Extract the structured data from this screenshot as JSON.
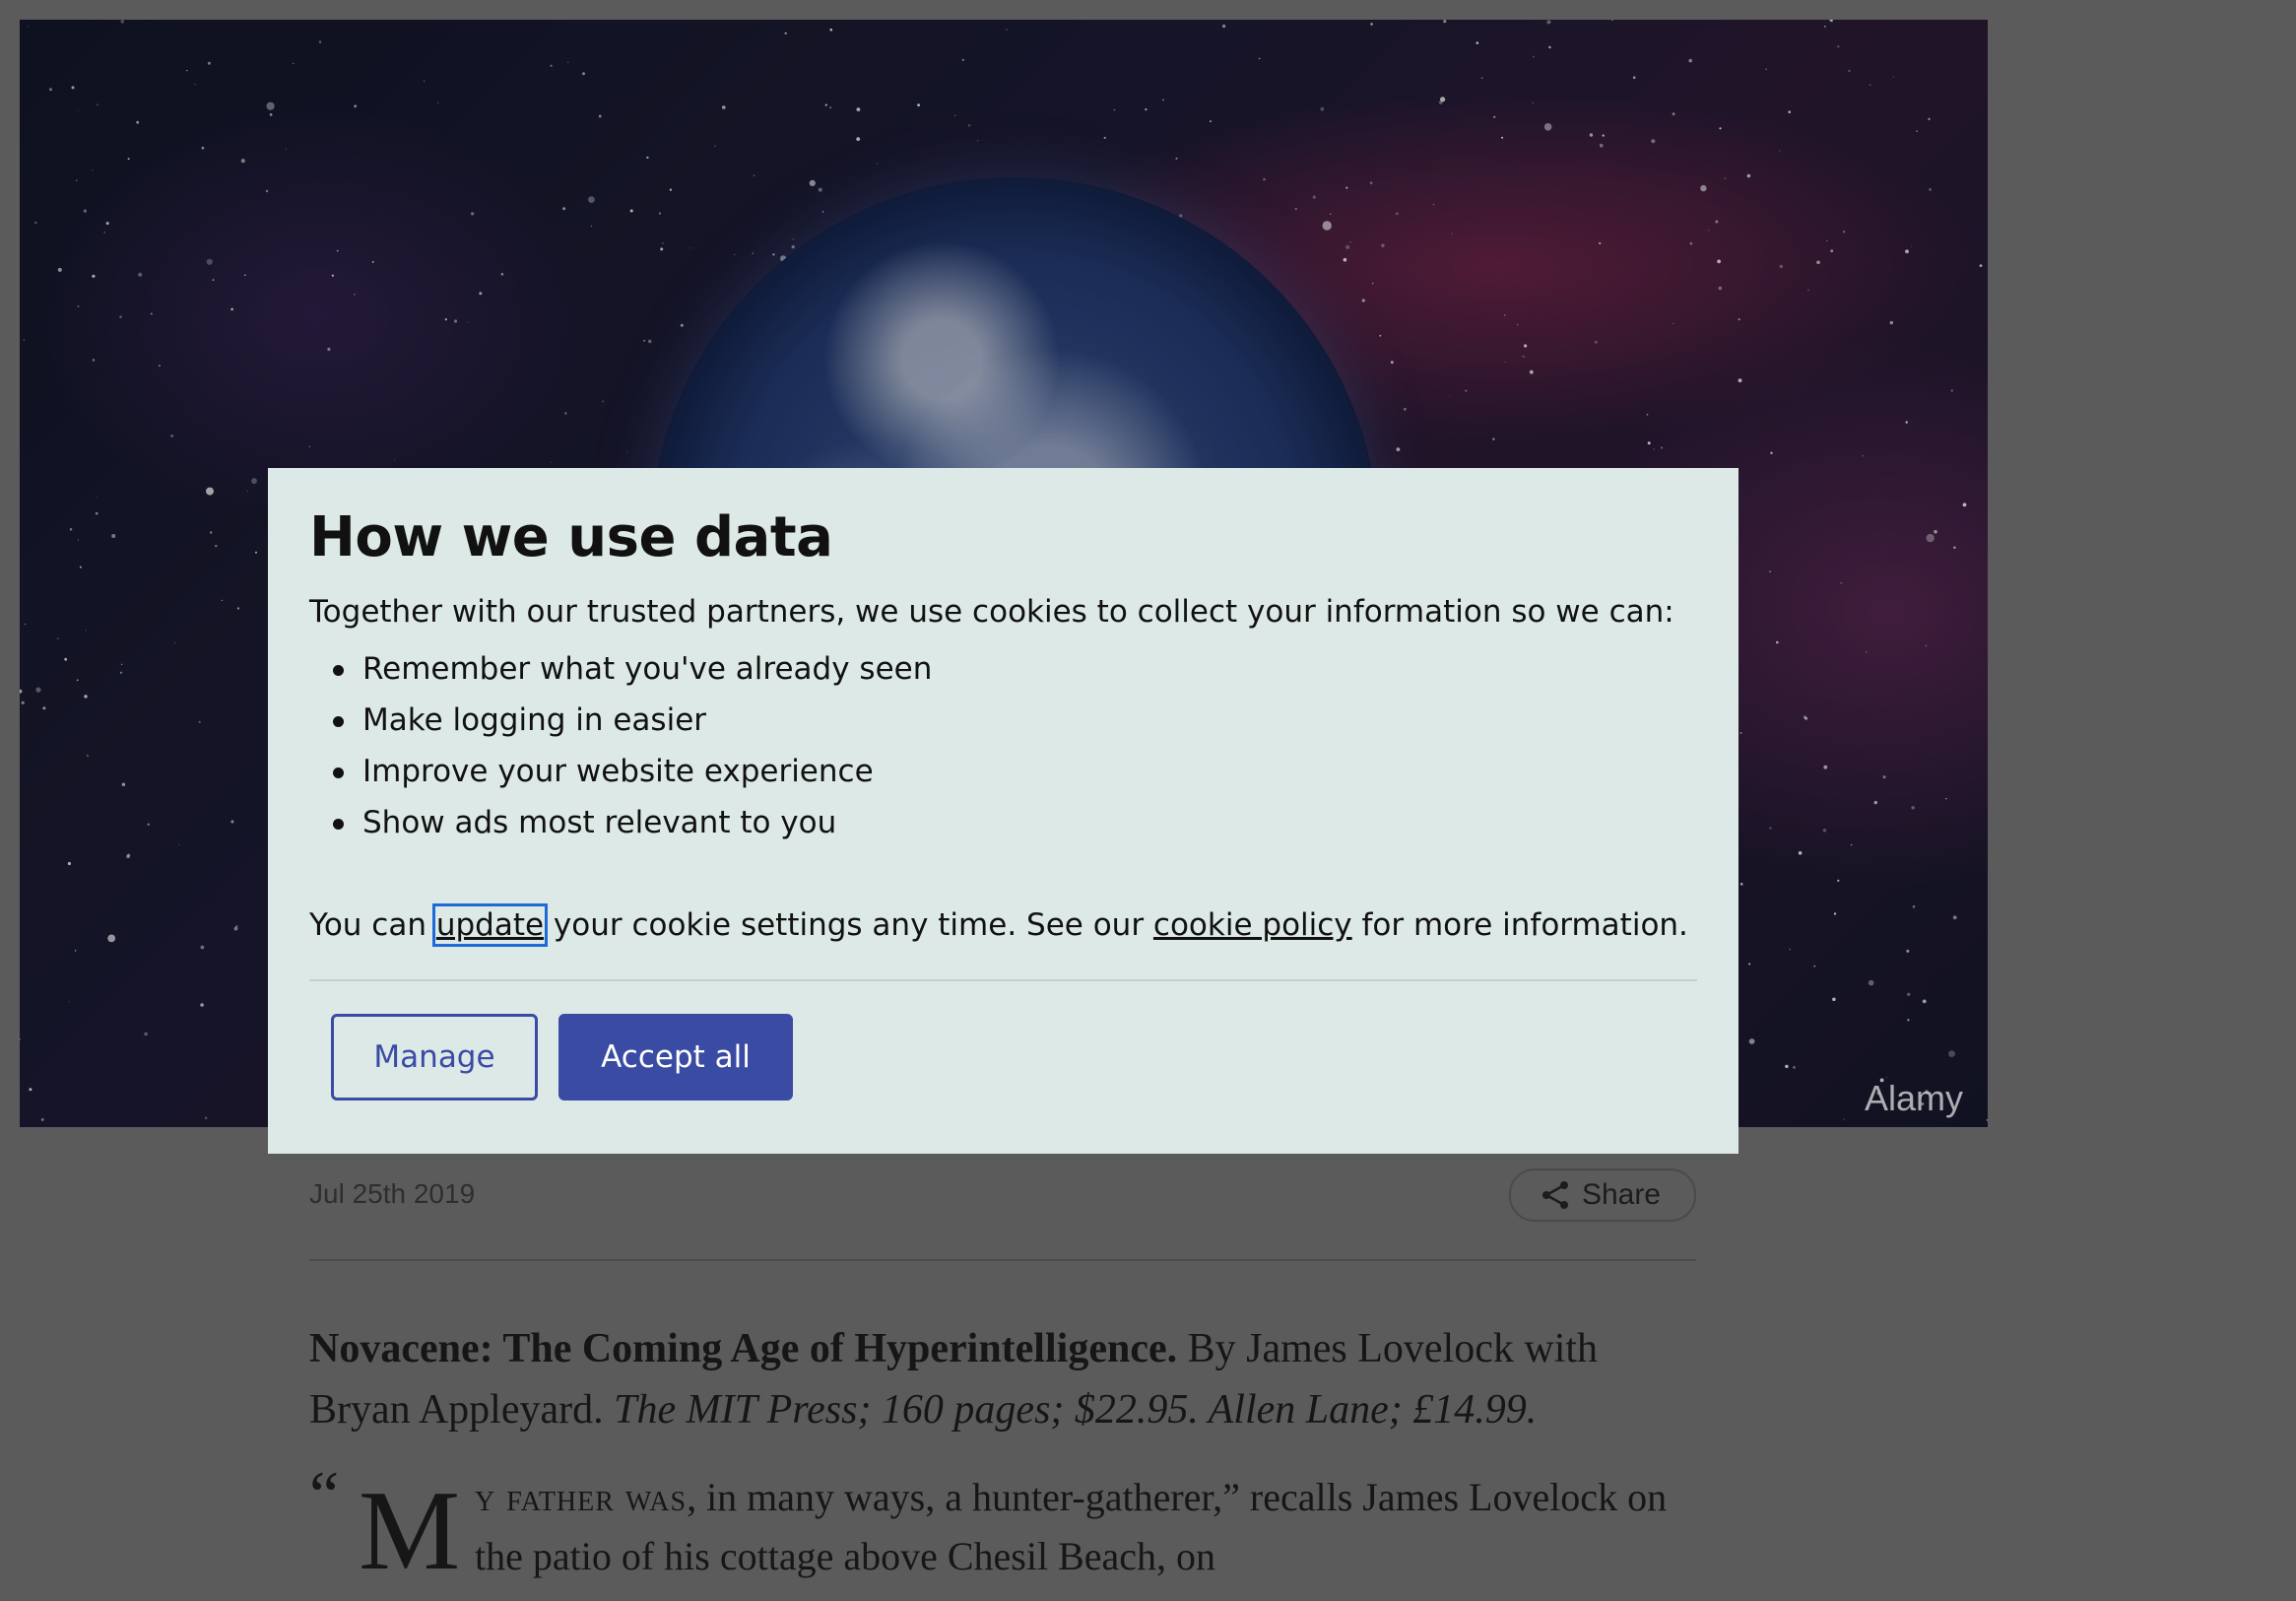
{
  "hero": {
    "photo_credit": "Alamy"
  },
  "cookie_dialog": {
    "title": "How we use data",
    "intro": "Together with our trusted partners, we use cookies to collect your information so we can:",
    "items": [
      "Remember what you've already seen",
      "Make logging in easier",
      "Improve your website experience",
      "Show ads most relevant to you"
    ],
    "footer": {
      "prefix": "You can ",
      "update_link": "update",
      "middle": " your cookie settings any time. See our ",
      "policy_link": "cookie policy",
      "suffix": " for more information."
    },
    "buttons": {
      "manage": "Manage",
      "accept": "Accept all"
    },
    "colors": {
      "background": "#dde9e7",
      "accent": "#3a4ba4",
      "focus_ring": "#1e6bd6"
    }
  },
  "article": {
    "date": "Jul 25th 2019",
    "share_label": "Share",
    "share_icon": "share-icon",
    "book": {
      "title": "Novacene: The Coming Age of Hyperintelligence.",
      "authors": " By James Lovelock with Bryan Appleyard. ",
      "publisher_us": "The MIT Press; 160 pages; $22.95.",
      "publisher_uk": " Allen Lane; £14.99."
    },
    "lede": {
      "quote_mark": "“",
      "dropcap": "M",
      "smallcaps": "y father was",
      "text": ", in many ways, a hunter-gatherer,” recalls James Lovelock on the patio of his cottage above Chesil Beach, on"
    }
  }
}
